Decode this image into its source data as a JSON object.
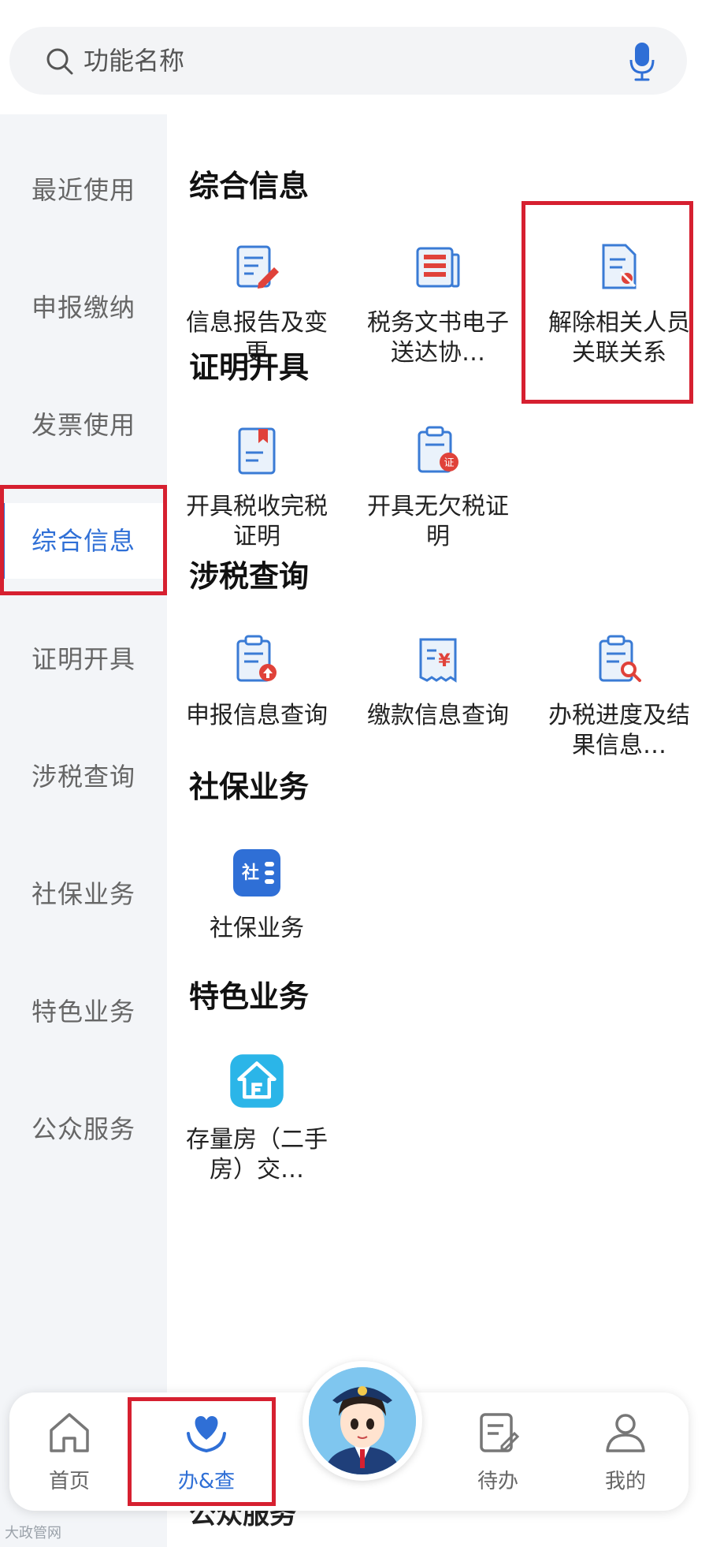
{
  "search": {
    "placeholder": "功能名称"
  },
  "sidebar": {
    "items": [
      {
        "label": "最近使用"
      },
      {
        "label": "申报缴纳"
      },
      {
        "label": "发票使用"
      },
      {
        "label": "综合信息",
        "active": true
      },
      {
        "label": "证明开具"
      },
      {
        "label": "涉税查询"
      },
      {
        "label": "社保业务"
      },
      {
        "label": "特色业务"
      },
      {
        "label": "公众服务"
      }
    ]
  },
  "sections": [
    {
      "title": "综合信息",
      "items": [
        {
          "label": "信息报告及变更",
          "icon": "document-edit-icon"
        },
        {
          "label": "税务文书电子送达协…",
          "icon": "newspaper-icon"
        },
        {
          "label": "解除相关人员关联关系",
          "icon": "document-unlink-icon"
        }
      ]
    },
    {
      "title": "证明开具",
      "items": [
        {
          "label": "开具税收完税证明",
          "icon": "document-bookmark-icon"
        },
        {
          "label": "开具无欠税证明",
          "icon": "certificate-icon"
        }
      ]
    },
    {
      "title": "涉税查询",
      "items": [
        {
          "label": "申报信息查询",
          "icon": "clipboard-upload-icon"
        },
        {
          "label": "缴款信息查询",
          "icon": "receipt-yen-icon"
        },
        {
          "label": "办税进度及结果信息…",
          "icon": "clipboard-search-icon"
        }
      ]
    },
    {
      "title": "社保业务",
      "items": [
        {
          "label": "社保业务",
          "icon": "social-security-icon",
          "icon_text": "社"
        }
      ]
    },
    {
      "title": "特色业务",
      "items": [
        {
          "label": "存量房（二手房）交…",
          "icon": "house-icon"
        }
      ]
    }
  ],
  "partial_section": {
    "title": "公众服务"
  },
  "bottom_nav": {
    "items": [
      {
        "label": "首页",
        "icon": "home-icon"
      },
      {
        "label": "办&查",
        "icon": "heart-hands-icon",
        "active": true
      },
      {
        "label": "",
        "icon": "assistant-avatar-icon"
      },
      {
        "label": "待办",
        "icon": "todo-icon"
      },
      {
        "label": "我的",
        "icon": "user-icon"
      }
    ]
  },
  "colors": {
    "accent": "#2f6fd6",
    "highlight": "#d62030",
    "icon_red": "#e0423a"
  },
  "watermark": "大政管网"
}
